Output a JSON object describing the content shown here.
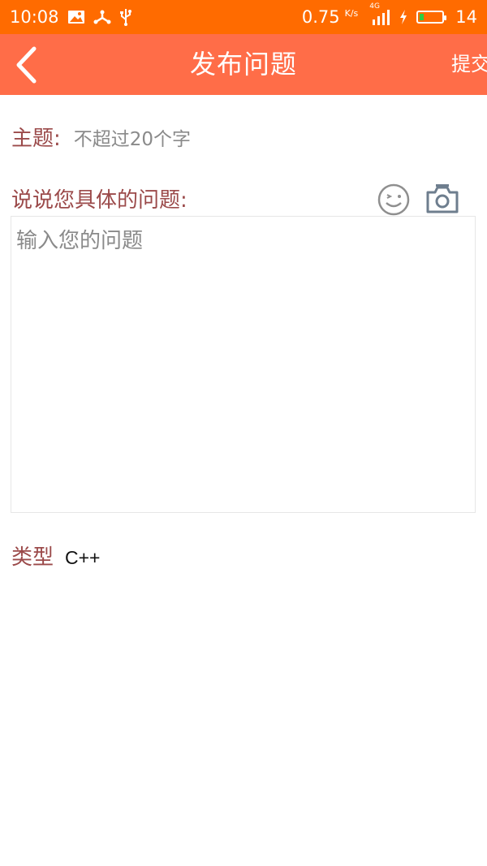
{
  "status_bar": {
    "time": "10:08",
    "speed": "0.75",
    "speed_unit": "K/s",
    "network": "4G",
    "battery_level": "14",
    "icons": [
      "image-icon",
      "usb-share-icon",
      "usb-icon",
      "signal-icon",
      "charging-icon",
      "battery-icon"
    ]
  },
  "app_bar": {
    "title": "发布问题",
    "submit_label": "提交",
    "back_icon": "chevron-left-icon"
  },
  "form": {
    "subject_label": "主题:",
    "subject_placeholder": "不超过20个字",
    "description_label": "说说您具体的问题:",
    "description_placeholder": "输入您的问题",
    "type_label": "类型",
    "type_value": "C++"
  },
  "colors": {
    "status_bar": "#ff6b00",
    "app_bar": "#ff6d48",
    "label": "#9b4a4a",
    "placeholder": "#8a8a8a"
  }
}
